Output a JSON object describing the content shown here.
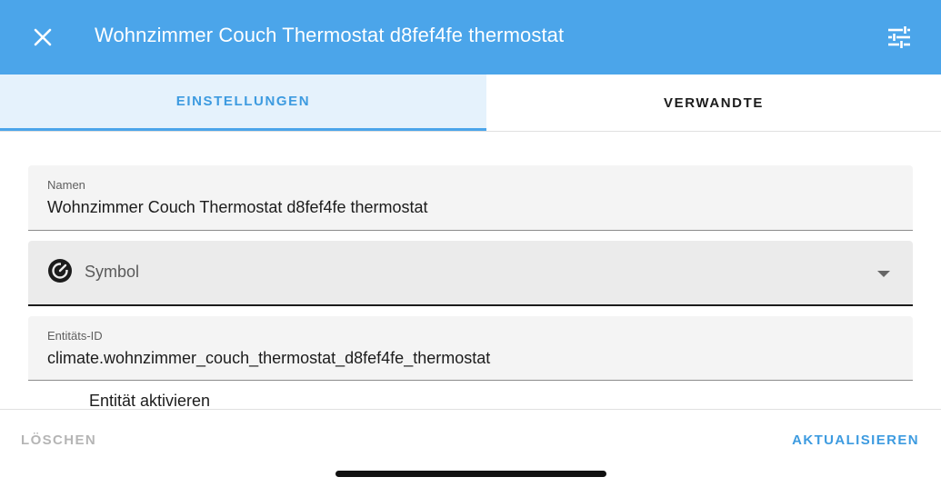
{
  "header": {
    "title": "Wohnzimmer Couch Thermostat d8fef4fe thermostat",
    "close_icon": "close-icon",
    "settings_icon": "tune-icon"
  },
  "tabs": [
    {
      "label": "EINSTELLUNGEN",
      "active": true
    },
    {
      "label": "VERWANDTE",
      "active": false
    }
  ],
  "form": {
    "name_field": {
      "label": "Namen",
      "value": "Wohnzimmer Couch Thermostat d8fef4fe thermostat"
    },
    "symbol_field": {
      "placeholder": "Symbol",
      "icon": "thermostat-dial-icon"
    },
    "entity_id_field": {
      "label": "Entitäts-ID",
      "value": "climate.wohnzimmer_couch_thermostat_d8fef4fe_thermostat"
    },
    "enable_entity_label": "Entität aktivieren"
  },
  "footer": {
    "delete_label": "LÖSCHEN",
    "update_label": "AKTUALISIEREN"
  },
  "colors": {
    "header_bg": "#4ba5ea",
    "accent": "#3d9be0",
    "active_tab_bg": "#e5f2fc"
  }
}
